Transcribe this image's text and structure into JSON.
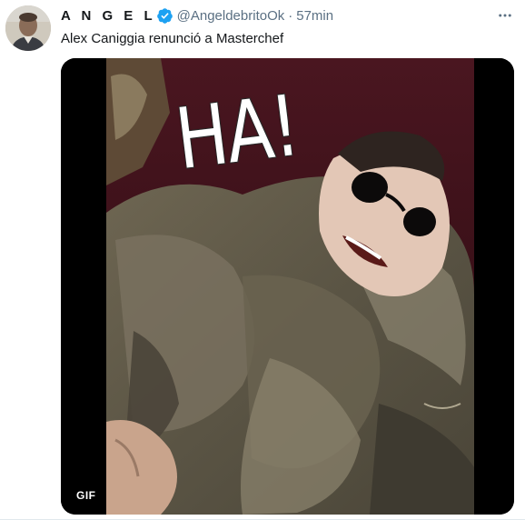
{
  "tweet": {
    "author_name": "A N G E L",
    "handle": "@AngeldebritoOk",
    "separator": "·",
    "time": "57min",
    "text": "Alex Caniggia renunció a Masterchef",
    "media": {
      "overlay_text": "HA!",
      "badge": "GIF"
    }
  },
  "icons": {
    "verified": "verified-badge-icon",
    "more": "more-options-icon"
  },
  "colors": {
    "verified_blue": "#1da1f2",
    "secondary_text": "#5b7083",
    "primary_text": "#14171a"
  }
}
